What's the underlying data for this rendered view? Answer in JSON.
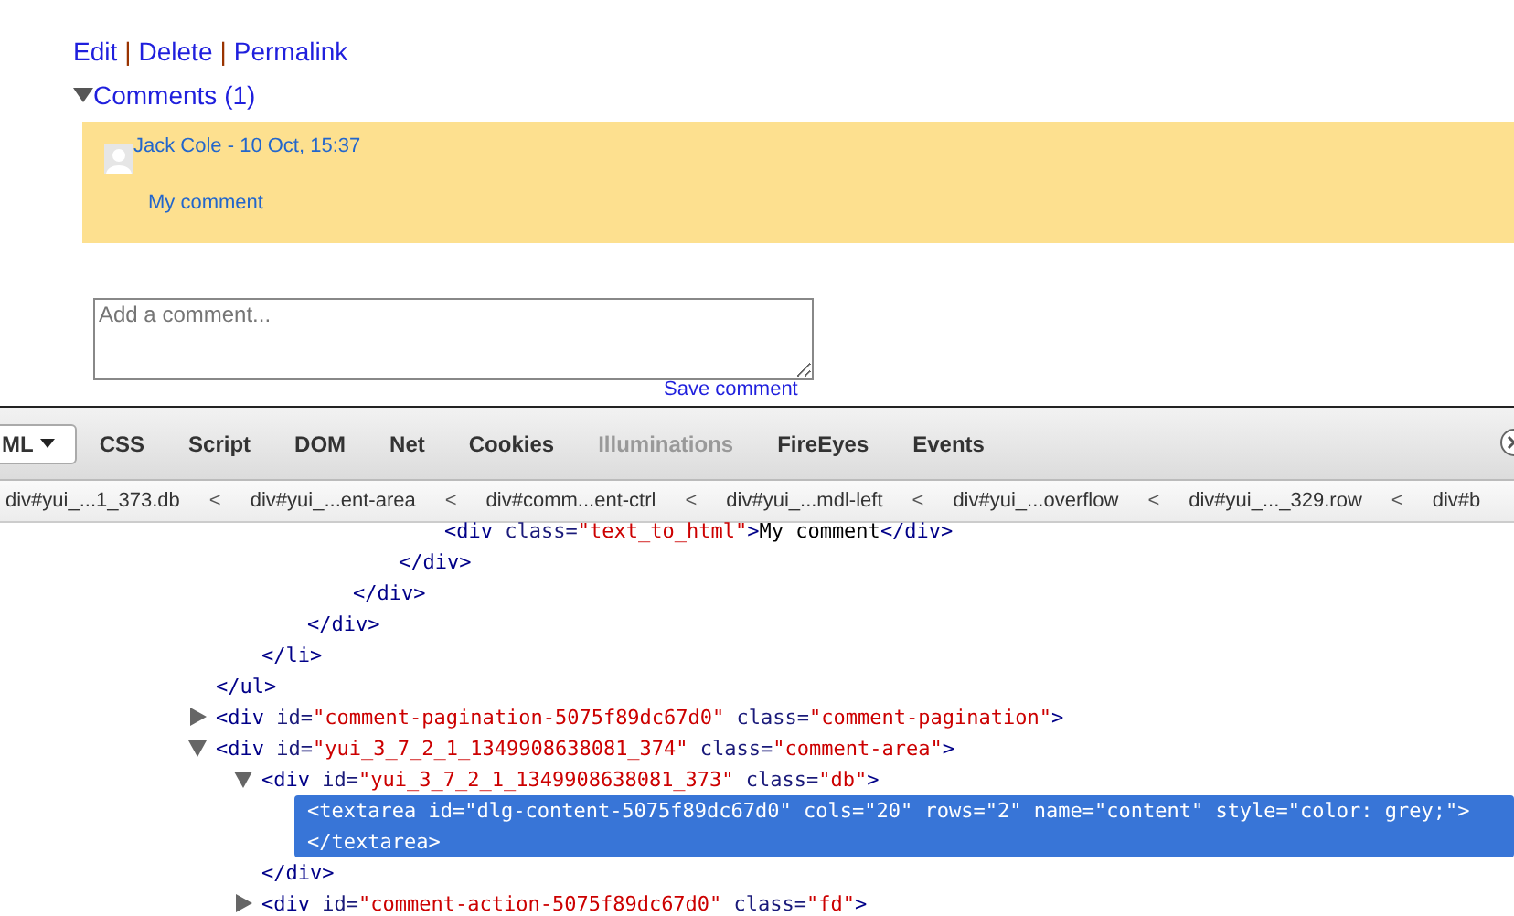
{
  "post_actions": [
    {
      "label": "Edit"
    },
    {
      "label": "Delete"
    },
    {
      "label": "Permalink"
    }
  ],
  "separator": "|",
  "comments_toggle": {
    "label": "Comments (1)",
    "expanded": true
  },
  "comments": [
    {
      "author": "Jack Cole - 10 Oct, 15:37",
      "text": "My comment"
    }
  ],
  "comment_field": {
    "placeholder": "Add a comment..."
  },
  "save_link": "Save comment",
  "devtools": {
    "tabs": [
      {
        "label": "ML",
        "dropdown": true,
        "selected": true,
        "disabled": false
      },
      {
        "label": "CSS",
        "dropdown": false,
        "selected": false,
        "disabled": false
      },
      {
        "label": "Script",
        "dropdown": false,
        "selected": false,
        "disabled": false
      },
      {
        "label": "DOM",
        "dropdown": false,
        "selected": false,
        "disabled": false
      },
      {
        "label": "Net",
        "dropdown": false,
        "selected": false,
        "disabled": false
      },
      {
        "label": "Cookies",
        "dropdown": false,
        "selected": false,
        "disabled": false
      },
      {
        "label": "Illuminations",
        "dropdown": false,
        "selected": false,
        "disabled": true
      },
      {
        "label": "FireEyes",
        "dropdown": false,
        "selected": false,
        "disabled": false
      },
      {
        "label": "Events",
        "dropdown": false,
        "selected": false,
        "disabled": false
      }
    ],
    "breadcrumb_separator": "<",
    "breadcrumbs": [
      "div#yui_...1_373.db",
      "div#yui_...ent-area",
      "div#comm...ent-ctrl",
      "div#yui_...mdl-left",
      "div#yui_...overflow",
      "div#yui_..._329.row",
      "div#b"
    ],
    "tree": [
      {
        "selected": false,
        "end": [
          {
            "kind": "tag",
            "text": "</ul>"
          }
        ],
        "children": [
          {
            "selected": false,
            "end": [
              {
                "kind": "tag",
                "text": "</li>"
              }
            ],
            "children": [
              {
                "selected": false,
                "end": [
                  {
                    "kind": "tag",
                    "text": "</div>"
                  }
                ],
                "children": [
                  {
                    "selected": false,
                    "end": [
                      {
                        "kind": "tag",
                        "text": "</div>"
                      }
                    ],
                    "children": [
                      {
                        "selected": false,
                        "end": [
                          {
                            "kind": "tag",
                            "text": "</div>"
                          }
                        ],
                        "children": [
                          {
                            "selected": false,
                            "line": [
                              {
                                "kind": "tag",
                                "text": "<div"
                              },
                              {
                                "kind": "attr",
                                "text": " class="
                              },
                              {
                                "kind": "value",
                                "text": "\"text_to_html\""
                              },
                              {
                                "kind": "tag",
                                "text": ">"
                              },
                              {
                                "kind": "text",
                                "text": "My comment"
                              },
                              {
                                "kind": "tag",
                                "text": "</div>"
                              }
                            ]
                          }
                        ]
                      }
                    ]
                  }
                ]
              }
            ]
          }
        ]
      },
      {
        "expanded": false,
        "selected": false,
        "line": [
          {
            "kind": "tag",
            "text": "<div"
          },
          {
            "kind": "attr",
            "text": " id="
          },
          {
            "kind": "value",
            "text": "\"comment-pagination-5075f89dc67d0\""
          },
          {
            "kind": "attr",
            "text": " class="
          },
          {
            "kind": "value",
            "text": "\"comment-pagination\""
          },
          {
            "kind": "tag",
            "text": ">"
          }
        ]
      },
      {
        "expanded": true,
        "selected": false,
        "line": [
          {
            "kind": "tag",
            "text": "<div"
          },
          {
            "kind": "attr",
            "text": " id="
          },
          {
            "kind": "value",
            "text": "\"yui_3_7_2_1_1349908638081_374\""
          },
          {
            "kind": "attr",
            "text": " class="
          },
          {
            "kind": "value",
            "text": "\"comment-area\""
          },
          {
            "kind": "tag",
            "text": ">"
          }
        ],
        "children": [
          {
            "expanded": true,
            "selected": false,
            "line": [
              {
                "kind": "tag",
                "text": "<div"
              },
              {
                "kind": "attr",
                "text": " id="
              },
              {
                "kind": "value",
                "text": "\"yui_3_7_2_1_1349908638081_373\""
              },
              {
                "kind": "attr",
                "text": " class="
              },
              {
                "kind": "value",
                "text": "\"db\""
              },
              {
                "kind": "tag",
                "text": ">"
              }
            ],
            "end": [
              {
                "kind": "tag",
                "text": "</div>"
              }
            ],
            "children": [
              {
                "selected": true,
                "line": [
                  {
                    "kind": "tag",
                    "text": "<textarea id=\"dlg-content-5075f89dc67d0\" cols=\"20\" rows=\"2\" name=\"content\" style=\"color: grey;\">"
                  }
                ],
                "end": [
                  {
                    "kind": "tag",
                    "text": "</textarea>"
                  }
                ]
              }
            ]
          },
          {
            "expanded": false,
            "selected": false,
            "line": [
              {
                "kind": "tag",
                "text": "<div"
              },
              {
                "kind": "attr",
                "text": " id="
              },
              {
                "kind": "value",
                "text": "\"comment-action-5075f89dc67d0\""
              },
              {
                "kind": "attr",
                "text": " class="
              },
              {
                "kind": "value",
                "text": "\"fd\""
              },
              {
                "kind": "tag",
                "text": ">"
              }
            ]
          }
        ]
      }
    ]
  }
}
